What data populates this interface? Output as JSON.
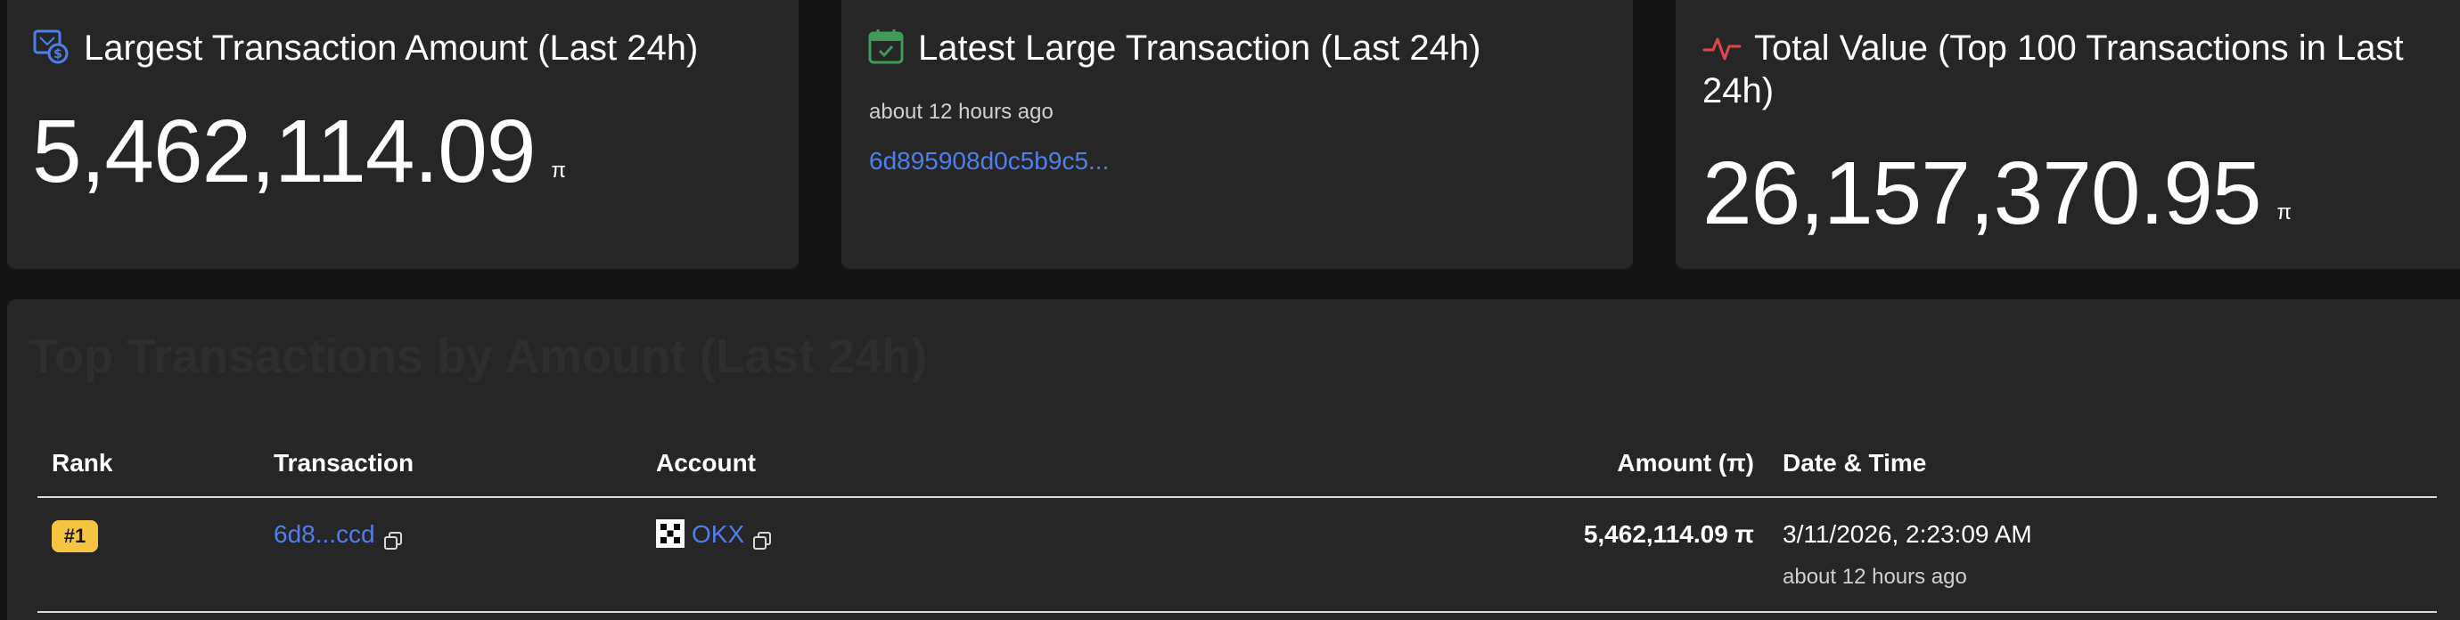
{
  "cards": [
    {
      "icon": "money-bag-icon",
      "title": "Largest Transaction Amount (Last 24h)",
      "value": "5,462,114.09",
      "unit": "π"
    },
    {
      "icon": "calendar-check-icon",
      "title": "Latest Large Transaction (Last 24h)",
      "relative_time": "about 12 hours ago",
      "tx_hash": "6d895908d0c5b9c5..."
    },
    {
      "icon": "activity-pulse-icon",
      "title_line1": "Total Value (Top 100 Transactions in Last",
      "title_line2": "24h)",
      "value": "26,157,370.95",
      "unit": "π"
    }
  ],
  "table": {
    "title": "Top Transactions by Amount (Last 24h)",
    "columns": [
      "Rank",
      "Transaction",
      "Account",
      "Amount (π)",
      "Date & Time"
    ],
    "rows": [
      {
        "rank": "#1",
        "transaction": "6d8...ccd",
        "account": "OKX",
        "amount": "5,462,114.09 π",
        "datetime": "3/11/2026, 2:23:09 AM",
        "relative": "about 12 hours ago"
      }
    ]
  },
  "colors": {
    "background": "#141414",
    "card": "#262626",
    "link": "#4f7fea",
    "badge": "#f5c542",
    "icon_blue": "#4f7fea",
    "icon_green": "#3f9b5a",
    "icon_red": "#e0474c"
  }
}
